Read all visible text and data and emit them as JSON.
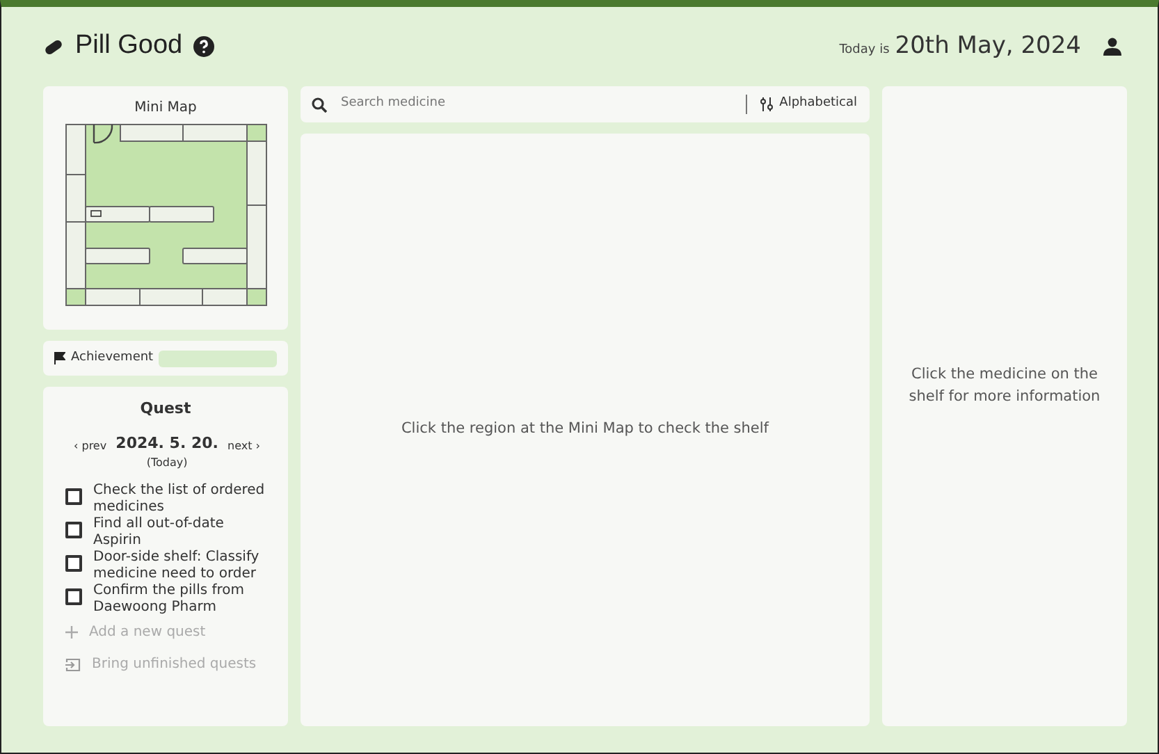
{
  "app": {
    "title": "Pill Good",
    "today_label": "Today is",
    "today_date": "20th May, 2024"
  },
  "mini_map": {
    "title": "Mini Map"
  },
  "achievement": {
    "label": "Achievement"
  },
  "quest": {
    "title": "Quest",
    "prev": "‹ prev",
    "next": "next ›",
    "date": "2024. 5. 20.",
    "date_note": "(Today)",
    "items": [
      {
        "text": "Check the list of ordered medicines",
        "checked": false
      },
      {
        "text": "Find all out-of-date Aspirin",
        "checked": false
      },
      {
        "text": "Door-side shelf: Classify medicine need to order",
        "checked": false
      },
      {
        "text": "Confirm the pills from Daewoong Pharm",
        "checked": false
      }
    ],
    "add": "Add a new quest",
    "bring": "Bring unfinished quests"
  },
  "search": {
    "placeholder": "Search medicine",
    "sort": "Alphabetical"
  },
  "shelf_panel": {
    "message": "Click the region at the Mini Map to check the shelf"
  },
  "info_panel": {
    "message": "Click the medicine on the shelf for more information"
  }
}
